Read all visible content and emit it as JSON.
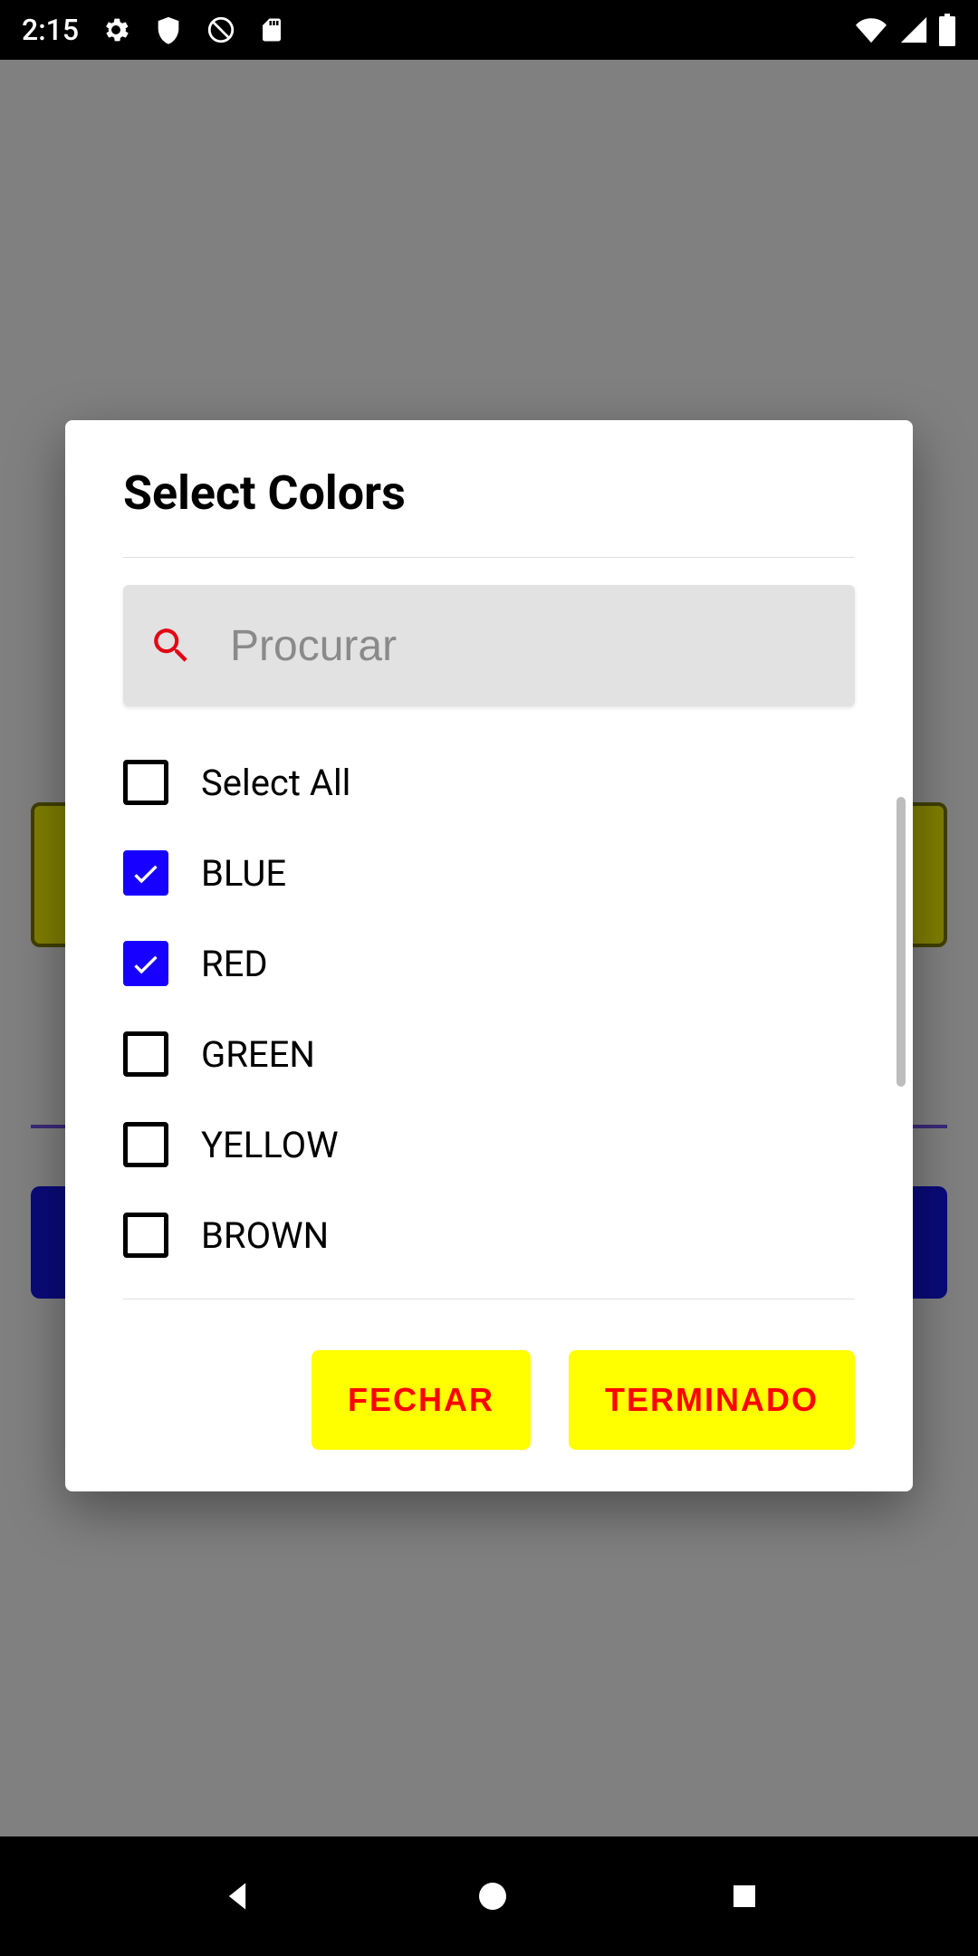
{
  "status": {
    "time": "2:15"
  },
  "dialog": {
    "title": "Select Colors",
    "search_placeholder": "Procurar",
    "select_all_label": "Select All",
    "items": [
      {
        "label": "BLUE",
        "checked": true
      },
      {
        "label": "RED",
        "checked": true
      },
      {
        "label": "GREEN",
        "checked": false
      },
      {
        "label": "YELLOW",
        "checked": false
      },
      {
        "label": "BROWN",
        "checked": false
      }
    ],
    "close_label": "FECHAR",
    "done_label": "TERMINADO"
  }
}
